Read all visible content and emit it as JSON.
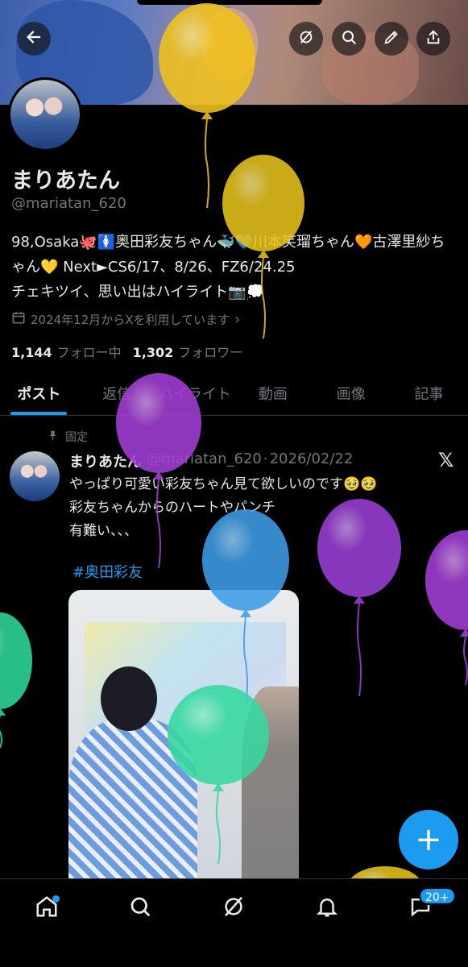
{
  "profile": {
    "name": "まりあたん",
    "handle": "@mariatan_620",
    "bio": "98,Osaka🐙🚺奥田彩友ちゃん🐳💙川本笑瑠ちゃん🧡古澤里紗ちゃん💛 Next►CS6/17、8/26、FZ6/24.25\nチェキツイ、思い出はハイライト📷💭",
    "joined": "2024年12月からXを利用しています",
    "following_count": "1,144",
    "following_label": "フォロー中",
    "followers_count": "1,302",
    "followers_label": "フォロワー"
  },
  "tabs": [
    "ポスト",
    "返信",
    "ハイライト",
    "動画",
    "画像",
    "記事"
  ],
  "active_tab": 0,
  "post": {
    "pinned_label": "固定",
    "author": "まりあたん",
    "handle": "@mariatan_620",
    "separator": "·",
    "date": "2026/02/22",
    "text": "やっぱり可愛い彩友ちゃん見て欲しいのです🥹🥹\n彩友ちゃんからのハートやパンチ\n有難い、、、",
    "hashtag": "#奥田彩友",
    "x_mark": "𝕏"
  },
  "fab": {
    "label": "+"
  },
  "nav": {
    "messages_badge": "20+"
  },
  "icons": [
    "back-arrow-icon",
    "grok-icon",
    "search-icon",
    "pen-icon",
    "share-icon",
    "calendar-icon",
    "pin-icon",
    "home-icon",
    "explore-icon",
    "grok-nav-icon",
    "bell-icon",
    "messages-icon"
  ],
  "colors": {
    "accent": "#1d9bf0",
    "background": "#000000",
    "text": "#e7e9ea",
    "muted": "#71767b"
  },
  "balloons": [
    {
      "color": "#f2c21c"
    },
    {
      "color": "#e8c21c"
    },
    {
      "color": "#a33fd6"
    },
    {
      "color": "#3e9ee8"
    },
    {
      "color": "#9a3fd6"
    },
    {
      "color": "#a33fd6"
    },
    {
      "color": "#2fd89a"
    },
    {
      "color": "#36d9a0"
    },
    {
      "color": "#e8c21c"
    }
  ]
}
